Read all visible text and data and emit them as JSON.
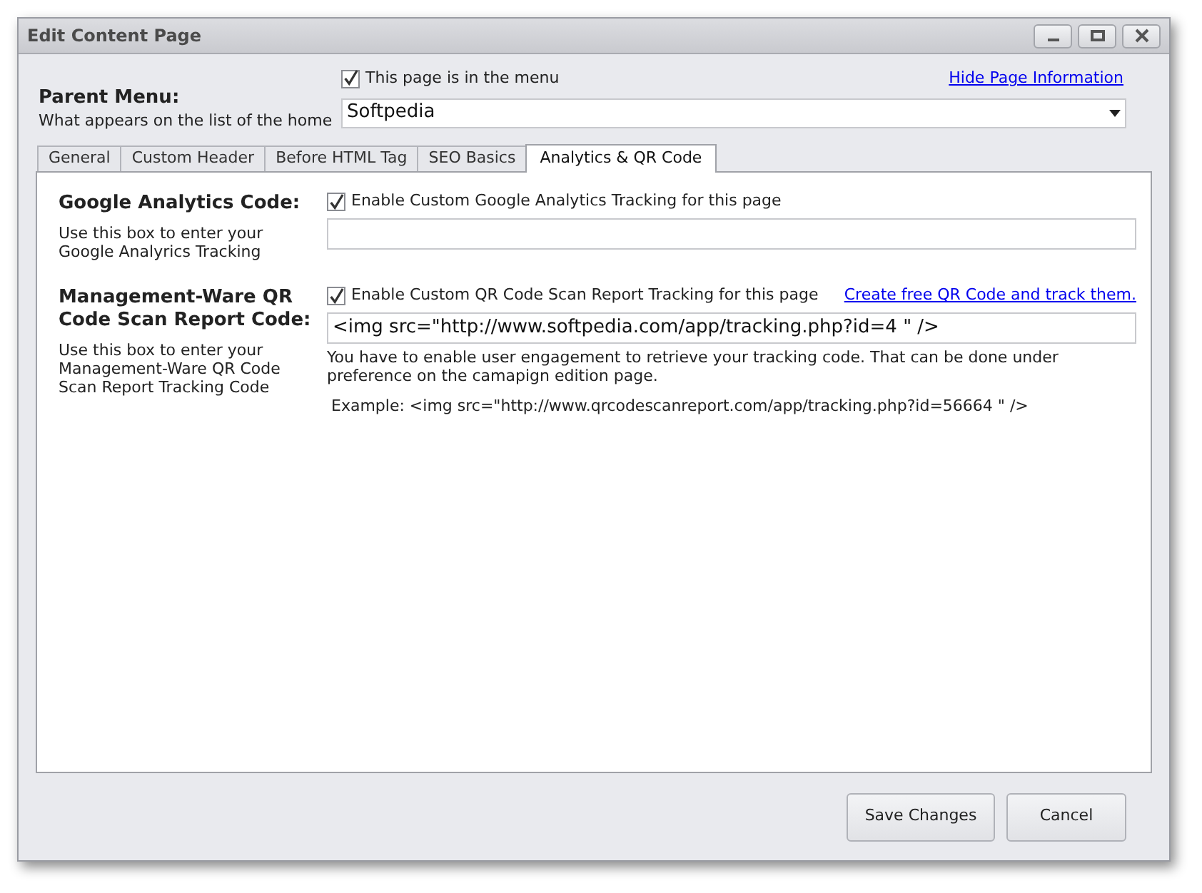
{
  "window": {
    "title": "Edit Content Page"
  },
  "parent_menu": {
    "title": "Parent Menu:",
    "description": "What appears on the list of the home",
    "in_menu": {
      "label": "This page is in the menu",
      "checked": true
    },
    "hide_link": "Hide Page Information",
    "dropdown": {
      "value": "Softpedia"
    }
  },
  "tabs": [
    {
      "label": "General",
      "selected": false
    },
    {
      "label": "Custom Header",
      "selected": false
    },
    {
      "label": "Before HTML Tag",
      "selected": false
    },
    {
      "label": "SEO Basics",
      "selected": false
    },
    {
      "label": "Analytics & QR Code",
      "selected": true
    }
  ],
  "sections": [
    {
      "title": "Google Analytics Code:",
      "description": "Use this box to enter your Google Analyrics Tracking",
      "checkbox": {
        "label": "Enable Custom Google Analytics Tracking for this page",
        "checked": true
      }
    },
    {
      "title": "Management-Ware QR Code Scan Report Code:",
      "description": "Use this box to enter your Management-Ware QR Code Scan Report Tracking Code",
      "checkbox": {
        "label": "Enable Custom QR Code Scan Report Tracking for this page",
        "checked": true
      },
      "link": "Create free QR Code and track them.",
      "field": {
        "value": "<img src=\"http://www.softpedia.com/app/tracking.php?id=4 \" />"
      },
      "note": "You have to enable user engagement to retrieve your tracking code. That can be done under preference on the camapign edition page.",
      "example": "Example: <img src=\"http://www.qrcodescanreport.com/app/tracking.php?id=56664 \" />"
    }
  ],
  "buttons": [
    "Save Changes",
    "Cancel"
  ]
}
